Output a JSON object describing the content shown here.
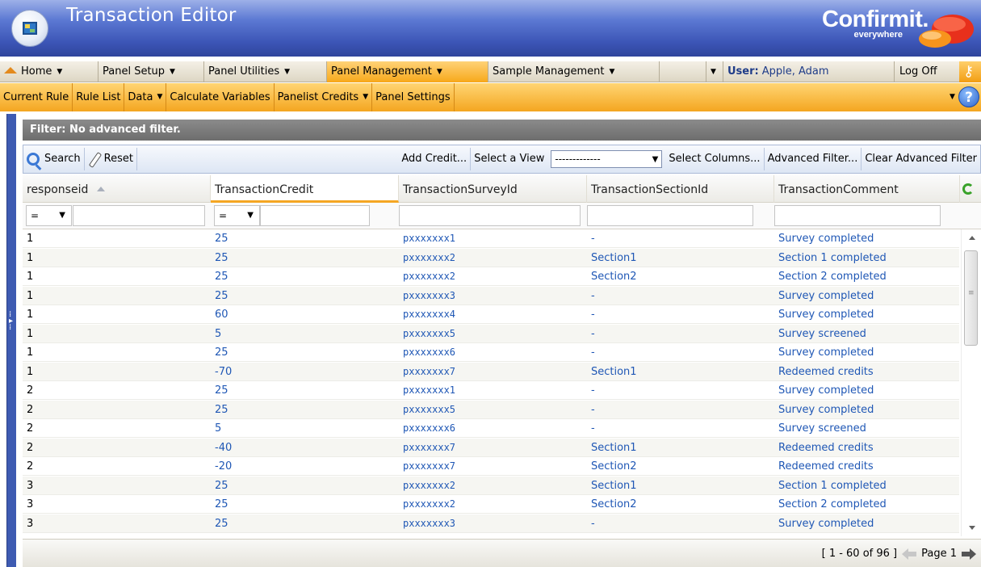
{
  "app": {
    "title": "Transaction Editor",
    "brand_name": "Confirmit.",
    "brand_tagline": "everywhere",
    "app_icon": "app-window-icon",
    "brand_logo": "speech-bubble-logo"
  },
  "main_menu": {
    "items": [
      {
        "label": "Home",
        "icon": "home-icon"
      },
      {
        "label": "Panel Setup"
      },
      {
        "label": "Panel Utilities"
      },
      {
        "label": "Panel Management",
        "active": true
      },
      {
        "label": "Sample Management"
      }
    ],
    "user_label": "User:",
    "user_name": "Apple, Adam",
    "logoff_label": "Log Off"
  },
  "sub_menu": {
    "items": [
      {
        "label": "Current Rule"
      },
      {
        "label": "Rule List"
      },
      {
        "label": "Data"
      },
      {
        "label": "Calculate Variables"
      },
      {
        "label": "Panelist Credits"
      },
      {
        "label": "Panel Settings"
      }
    ]
  },
  "filter": {
    "text": "Filter: No advanced filter."
  },
  "toolbar": {
    "search_label": "Search",
    "reset_label": "Reset",
    "add_credit_label": "Add Credit...",
    "select_view_label": "Select a View",
    "view_value": "-------------",
    "select_columns_label": "Select Columns...",
    "advanced_filter_label": "Advanced Filter...",
    "clear_filter_label": "Clear Advanced Filter"
  },
  "grid": {
    "columns": [
      "responseid",
      "TransactionCredit",
      "TransactionSurveyId",
      "TransactionSectionId",
      "TransactionComment"
    ],
    "operator": "=",
    "rows": [
      {
        "id": "1",
        "credit": "25",
        "survey": "pxxxxxxx1",
        "section": "-",
        "comment": "Survey completed"
      },
      {
        "id": "1",
        "credit": "25",
        "survey": "pxxxxxxx2",
        "section": "Section1",
        "comment": "Section 1 completed"
      },
      {
        "id": "1",
        "credit": "25",
        "survey": "pxxxxxxx2",
        "section": "Section2",
        "comment": "Section 2 completed"
      },
      {
        "id": "1",
        "credit": "25",
        "survey": "pxxxxxxx3",
        "section": "-",
        "comment": "Survey completed"
      },
      {
        "id": "1",
        "credit": "60",
        "survey": "pxxxxxxx4",
        "section": "-",
        "comment": "Survey completed"
      },
      {
        "id": "1",
        "credit": "5",
        "survey": "pxxxxxxx5",
        "section": "-",
        "comment": "Survey screened"
      },
      {
        "id": "1",
        "credit": "25",
        "survey": "pxxxxxxx6",
        "section": "-",
        "comment": "Survey completed"
      },
      {
        "id": "1",
        "credit": "-70",
        "survey": "pxxxxxxx7",
        "section": "Section1",
        "comment": "Redeemed credits"
      },
      {
        "id": "2",
        "credit": "25",
        "survey": "pxxxxxxx1",
        "section": "-",
        "comment": "Survey completed"
      },
      {
        "id": "2",
        "credit": "25",
        "survey": "pxxxxxxx5",
        "section": "-",
        "comment": "Survey completed"
      },
      {
        "id": "2",
        "credit": "5",
        "survey": "pxxxxxxx6",
        "section": "-",
        "comment": "Survey screened"
      },
      {
        "id": "2",
        "credit": "-40",
        "survey": "pxxxxxxx7",
        "section": "Section1",
        "comment": "Redeemed credits"
      },
      {
        "id": "2",
        "credit": "-20",
        "survey": "pxxxxxxx7",
        "section": "Section2",
        "comment": "Redeemed credits"
      },
      {
        "id": "3",
        "credit": "25",
        "survey": "pxxxxxxx2",
        "section": "Section1",
        "comment": "Section 1 completed"
      },
      {
        "id": "3",
        "credit": "25",
        "survey": "pxxxxxxx2",
        "section": "Section2",
        "comment": "Section 2 completed"
      },
      {
        "id": "3",
        "credit": "25",
        "survey": "pxxxxxxx3",
        "section": "-",
        "comment": "Survey completed"
      }
    ]
  },
  "pager": {
    "range_text": "[ 1 - 60 of 96 ]",
    "page_text": "Page 1"
  },
  "colors": {
    "title_bar": "#3c55b6",
    "active_menu": "#f7a81a",
    "sub_menu": "#f4a620",
    "link": "#1f57b5"
  }
}
